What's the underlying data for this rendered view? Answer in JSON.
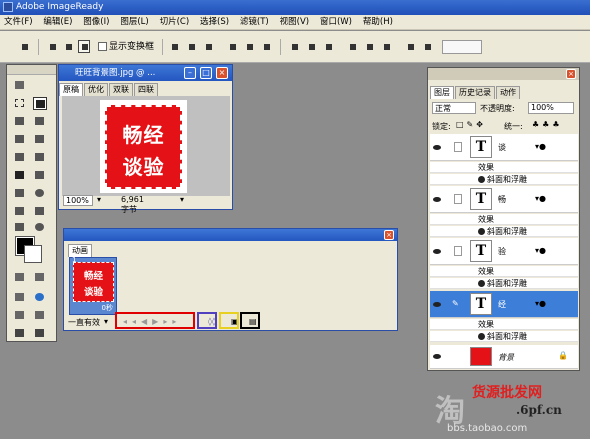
{
  "app": {
    "title": "Adobe ImageReady"
  },
  "menu": [
    "文件(F)",
    "编辑(E)",
    "图像(I)",
    "图层(L)",
    "切片(C)",
    "选择(S)",
    "滤镜(T)",
    "视图(V)",
    "窗口(W)",
    "帮助(H)"
  ],
  "options": {
    "show_transform": "显示变换框"
  },
  "image_window": {
    "title": "旺旺背景图.jpg @ ...",
    "tabs": [
      "原稿",
      "优化",
      "双联",
      "四联"
    ],
    "canvas_text_line1": "畅经",
    "canvas_text_line2": "谈验",
    "zoom": "100%",
    "size": "6,961 字节"
  },
  "animation": {
    "tab": "动画",
    "frame_number": "1",
    "frame_text_line1": "畅经",
    "frame_text_line2": "谈验",
    "frame_delay": "0秒",
    "loop": "一直有效"
  },
  "layers": {
    "tabs": [
      "图层",
      "历史记录",
      "动作"
    ],
    "blend_mode": "正常",
    "opacity_label": "不透明度:",
    "opacity": "100%",
    "lock_label": "锁定:",
    "unify_label": "统一:",
    "items": [
      {
        "name": "谈",
        "effects": "效果",
        "effect": "斜面和浮雕"
      },
      {
        "name": "畅",
        "effects": "效果",
        "effect": "斜面和浮雕"
      },
      {
        "name": "验",
        "effects": "效果",
        "effect": "斜面和浮雕"
      },
      {
        "name": "经",
        "effects": "效果",
        "effect": "斜面和浮雕"
      }
    ],
    "background": "背景",
    "thumb_t": "T"
  },
  "watermark": {
    "line1": "货源批发网",
    "line2": ".6pf.cn",
    "line3": "bbs.taobao.com",
    "big": "淘"
  },
  "colors": {
    "accent_red": "#e41216",
    "selection_blue": "#3d7ed8",
    "highlight_red": "#e00000",
    "highlight_purple": "#5040c0",
    "highlight_yellow": "#e8d020",
    "highlight_black": "#000000"
  }
}
